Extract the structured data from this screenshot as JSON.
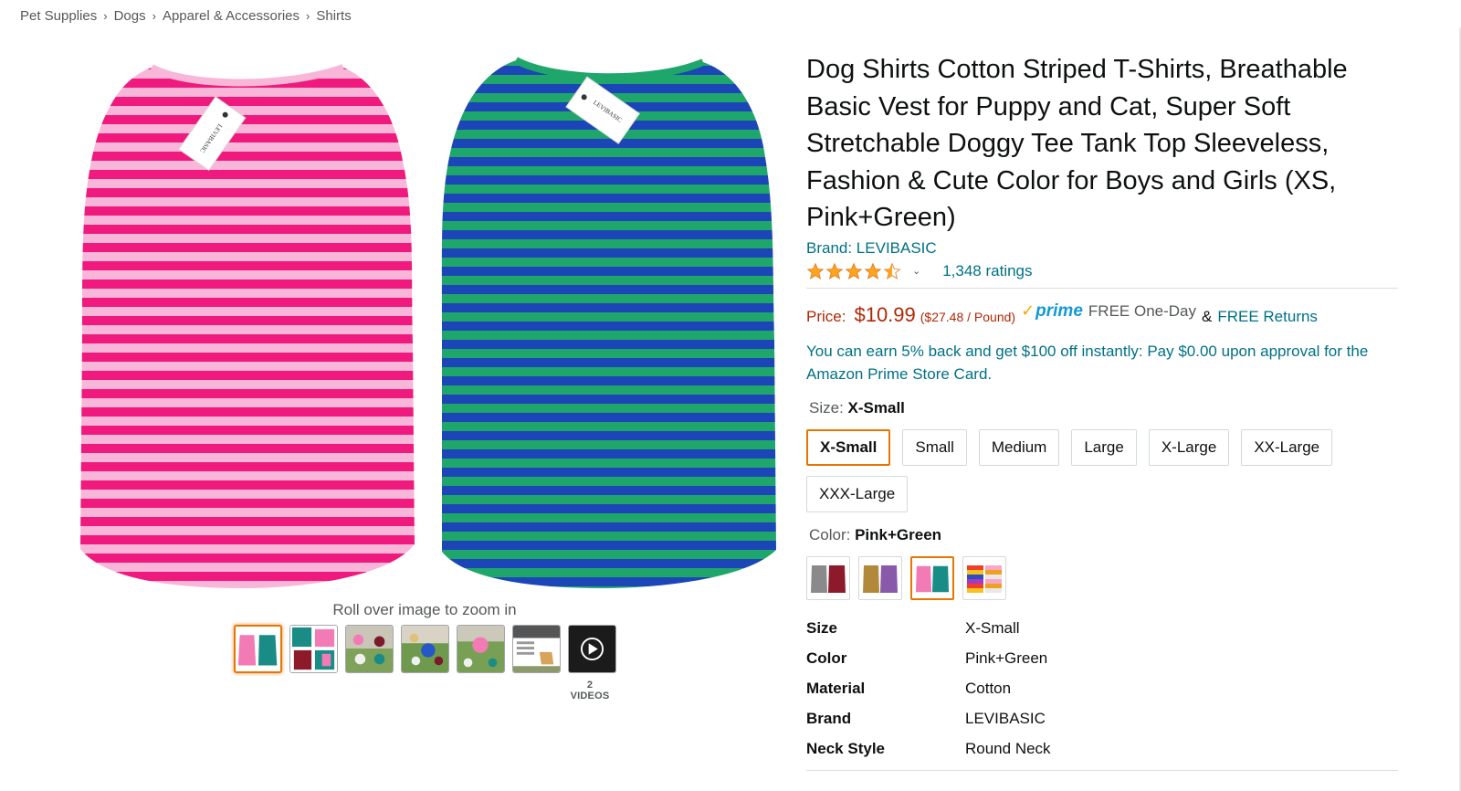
{
  "breadcrumb": [
    "Pet Supplies",
    "Dogs",
    "Apparel & Accessories",
    "Shirts"
  ],
  "breadcrumb_separator": "›",
  "gallery": {
    "zoom_hint": "Roll over image to zoom in",
    "videos_label": "2 VIDEOS",
    "tag_text": "LEVIBASIC",
    "selected_thumbnail": 0,
    "thumbnail_count": 7
  },
  "product": {
    "title": "Dog Shirts Cotton Striped T-Shirts, Breathable Basic Vest for Puppy and Cat, Super Soft Stretchable Doggy Tee Tank Top Sleeveless, Fashion & Cute Color for Boys and Girls (XS, Pink+Green)",
    "brand_link": "Brand: LEVIBASIC",
    "rating_stars": 4.5,
    "ratings_count": "1,348 ratings",
    "chevron": "⌄"
  },
  "pricing": {
    "label": "Price:",
    "price": "$10.99",
    "unit_price": "($27.48 / Pound)",
    "prime_check": "✓",
    "prime_word": "prime",
    "free_delivery": "FREE One-Day",
    "amp": "&",
    "free_returns": "FREE Returns",
    "promo": "You can earn 5% back and get $100 off instantly: Pay $0.00 upon approval for the Amazon Prime Store Card."
  },
  "size": {
    "label": "Size:",
    "selected": "X-Small",
    "options": [
      "X-Small",
      "Small",
      "Medium",
      "Large",
      "X-Large",
      "XX-Large",
      "XXX-Large"
    ]
  },
  "color": {
    "label": "Color:",
    "selected": "Pink+Green",
    "selected_index": 2
  },
  "specs": [
    {
      "key": "Size",
      "value": "X-Small"
    },
    {
      "key": "Color",
      "value": "Pink+Green"
    },
    {
      "key": "Material",
      "value": "Cotton"
    },
    {
      "key": "Brand",
      "value": "LEVIBASIC"
    },
    {
      "key": "Neck Style",
      "value": "Round Neck"
    }
  ],
  "colors": {
    "price_red": "#b12704",
    "link_teal": "#007185",
    "selected_orange": "#e77600",
    "star_orange": "#ffa41c",
    "pink_stripe": "#f0197d",
    "light_pink_stripe": "#f8b6d8",
    "green_stripe": "#1fa66a",
    "blue_stripe": "#1c45b8"
  }
}
